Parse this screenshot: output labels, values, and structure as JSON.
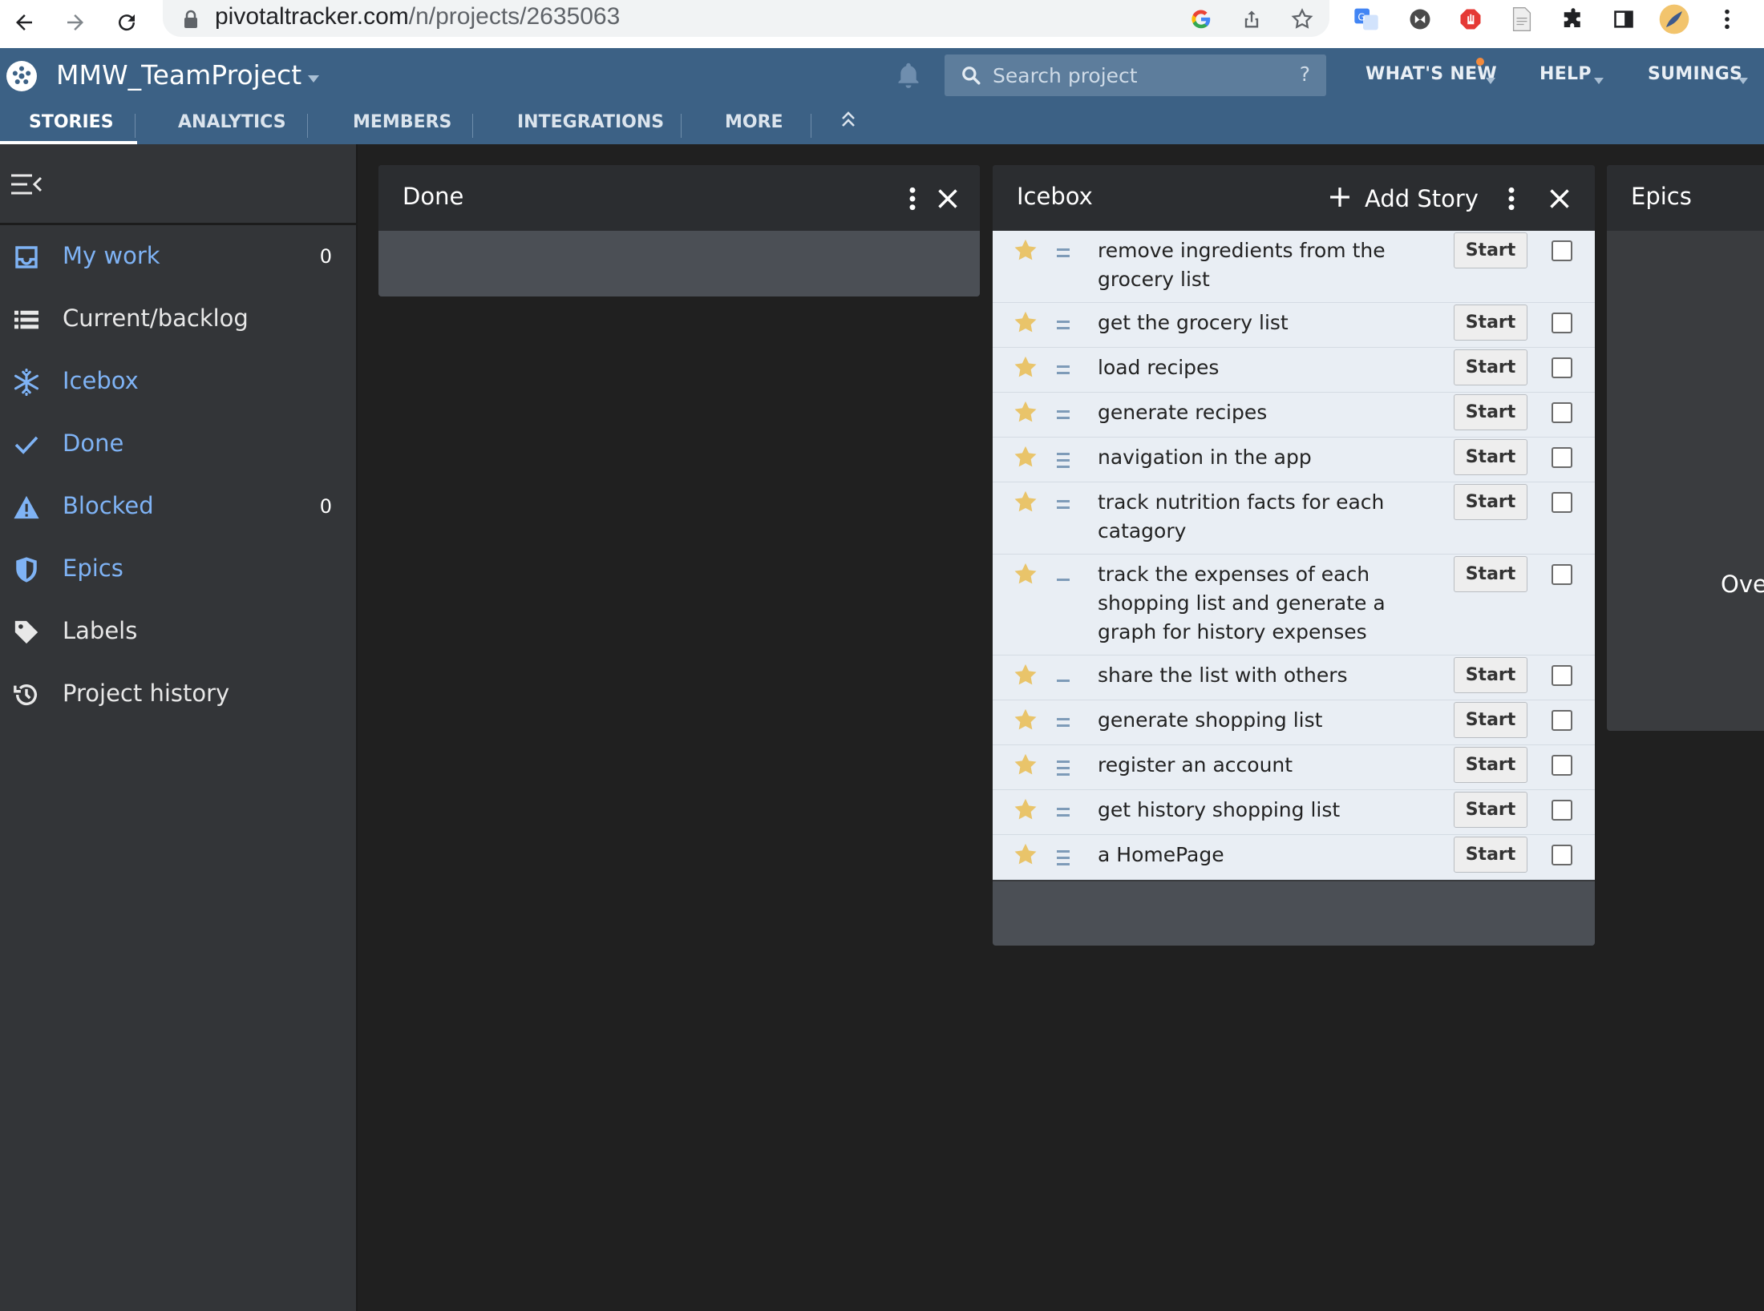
{
  "browser": {
    "url_host": "pivotaltracker.com",
    "url_path": "/n/projects/2635063"
  },
  "header": {
    "project_name": "MMW_TeamProject",
    "search_placeholder": "Search project",
    "search_help": "?",
    "whats_new": "WHAT'S NEW",
    "help": "HELP",
    "user": "SUMINGS"
  },
  "tabs": [
    {
      "label": "STORIES",
      "active": true
    },
    {
      "label": "ANALYTICS"
    },
    {
      "label": "MEMBERS"
    },
    {
      "label": "INTEGRATIONS"
    },
    {
      "label": "MORE"
    }
  ],
  "sidebar": {
    "items": [
      {
        "label": "My work",
        "count": "0",
        "icon": "inbox-icon",
        "color": "#7fb3f5"
      },
      {
        "label": "Current/backlog",
        "icon": "list-icon",
        "color": "#e8e8e8"
      },
      {
        "label": "Icebox",
        "icon": "snowflake-icon",
        "color": "#7fb3f5"
      },
      {
        "label": "Done",
        "icon": "checkmark-icon",
        "color": "#7fb3f5"
      },
      {
        "label": "Blocked",
        "count": "0",
        "icon": "warning-icon",
        "color": "#7fb3f5"
      },
      {
        "label": "Epics",
        "icon": "shield-icon",
        "color": "#7fb3f5"
      },
      {
        "label": "Labels",
        "icon": "tag-icon",
        "color": "#e8e8e8"
      },
      {
        "label": "Project history",
        "icon": "history-icon",
        "color": "#e8e8e8"
      }
    ]
  },
  "panels": {
    "done": {
      "title": "Done"
    },
    "icebox": {
      "title": "Icebox",
      "add_story": "Add Story",
      "start_label": "Start",
      "stories": [
        {
          "title": "remove ingredients from the grocery list",
          "estimate": 2
        },
        {
          "title": "get the grocery list",
          "estimate": 2
        },
        {
          "title": "load recipes",
          "estimate": 2
        },
        {
          "title": "generate recipes",
          "estimate": 2
        },
        {
          "title": "navigation in the app",
          "estimate": 3
        },
        {
          "title": "track nutrition facts for each catagory",
          "estimate": 2
        },
        {
          "title": "track the expenses of each shopping list and generate a graph for history expenses",
          "estimate": 1
        },
        {
          "title": "share the list with others",
          "estimate": 1
        },
        {
          "title": "generate shopping list",
          "estimate": 2
        },
        {
          "title": "register an account",
          "estimate": 3
        },
        {
          "title": "get history shopping list",
          "estimate": 2
        },
        {
          "title": "a HomePage",
          "estimate": 3
        }
      ]
    },
    "epics": {
      "title": "Epics",
      "partial_text": "Ove"
    }
  },
  "colors": {
    "header_bg": "#3c6185",
    "sidebar_bg": "#333538",
    "story_bg": "#e9eef4",
    "star": "#e9c46a"
  }
}
